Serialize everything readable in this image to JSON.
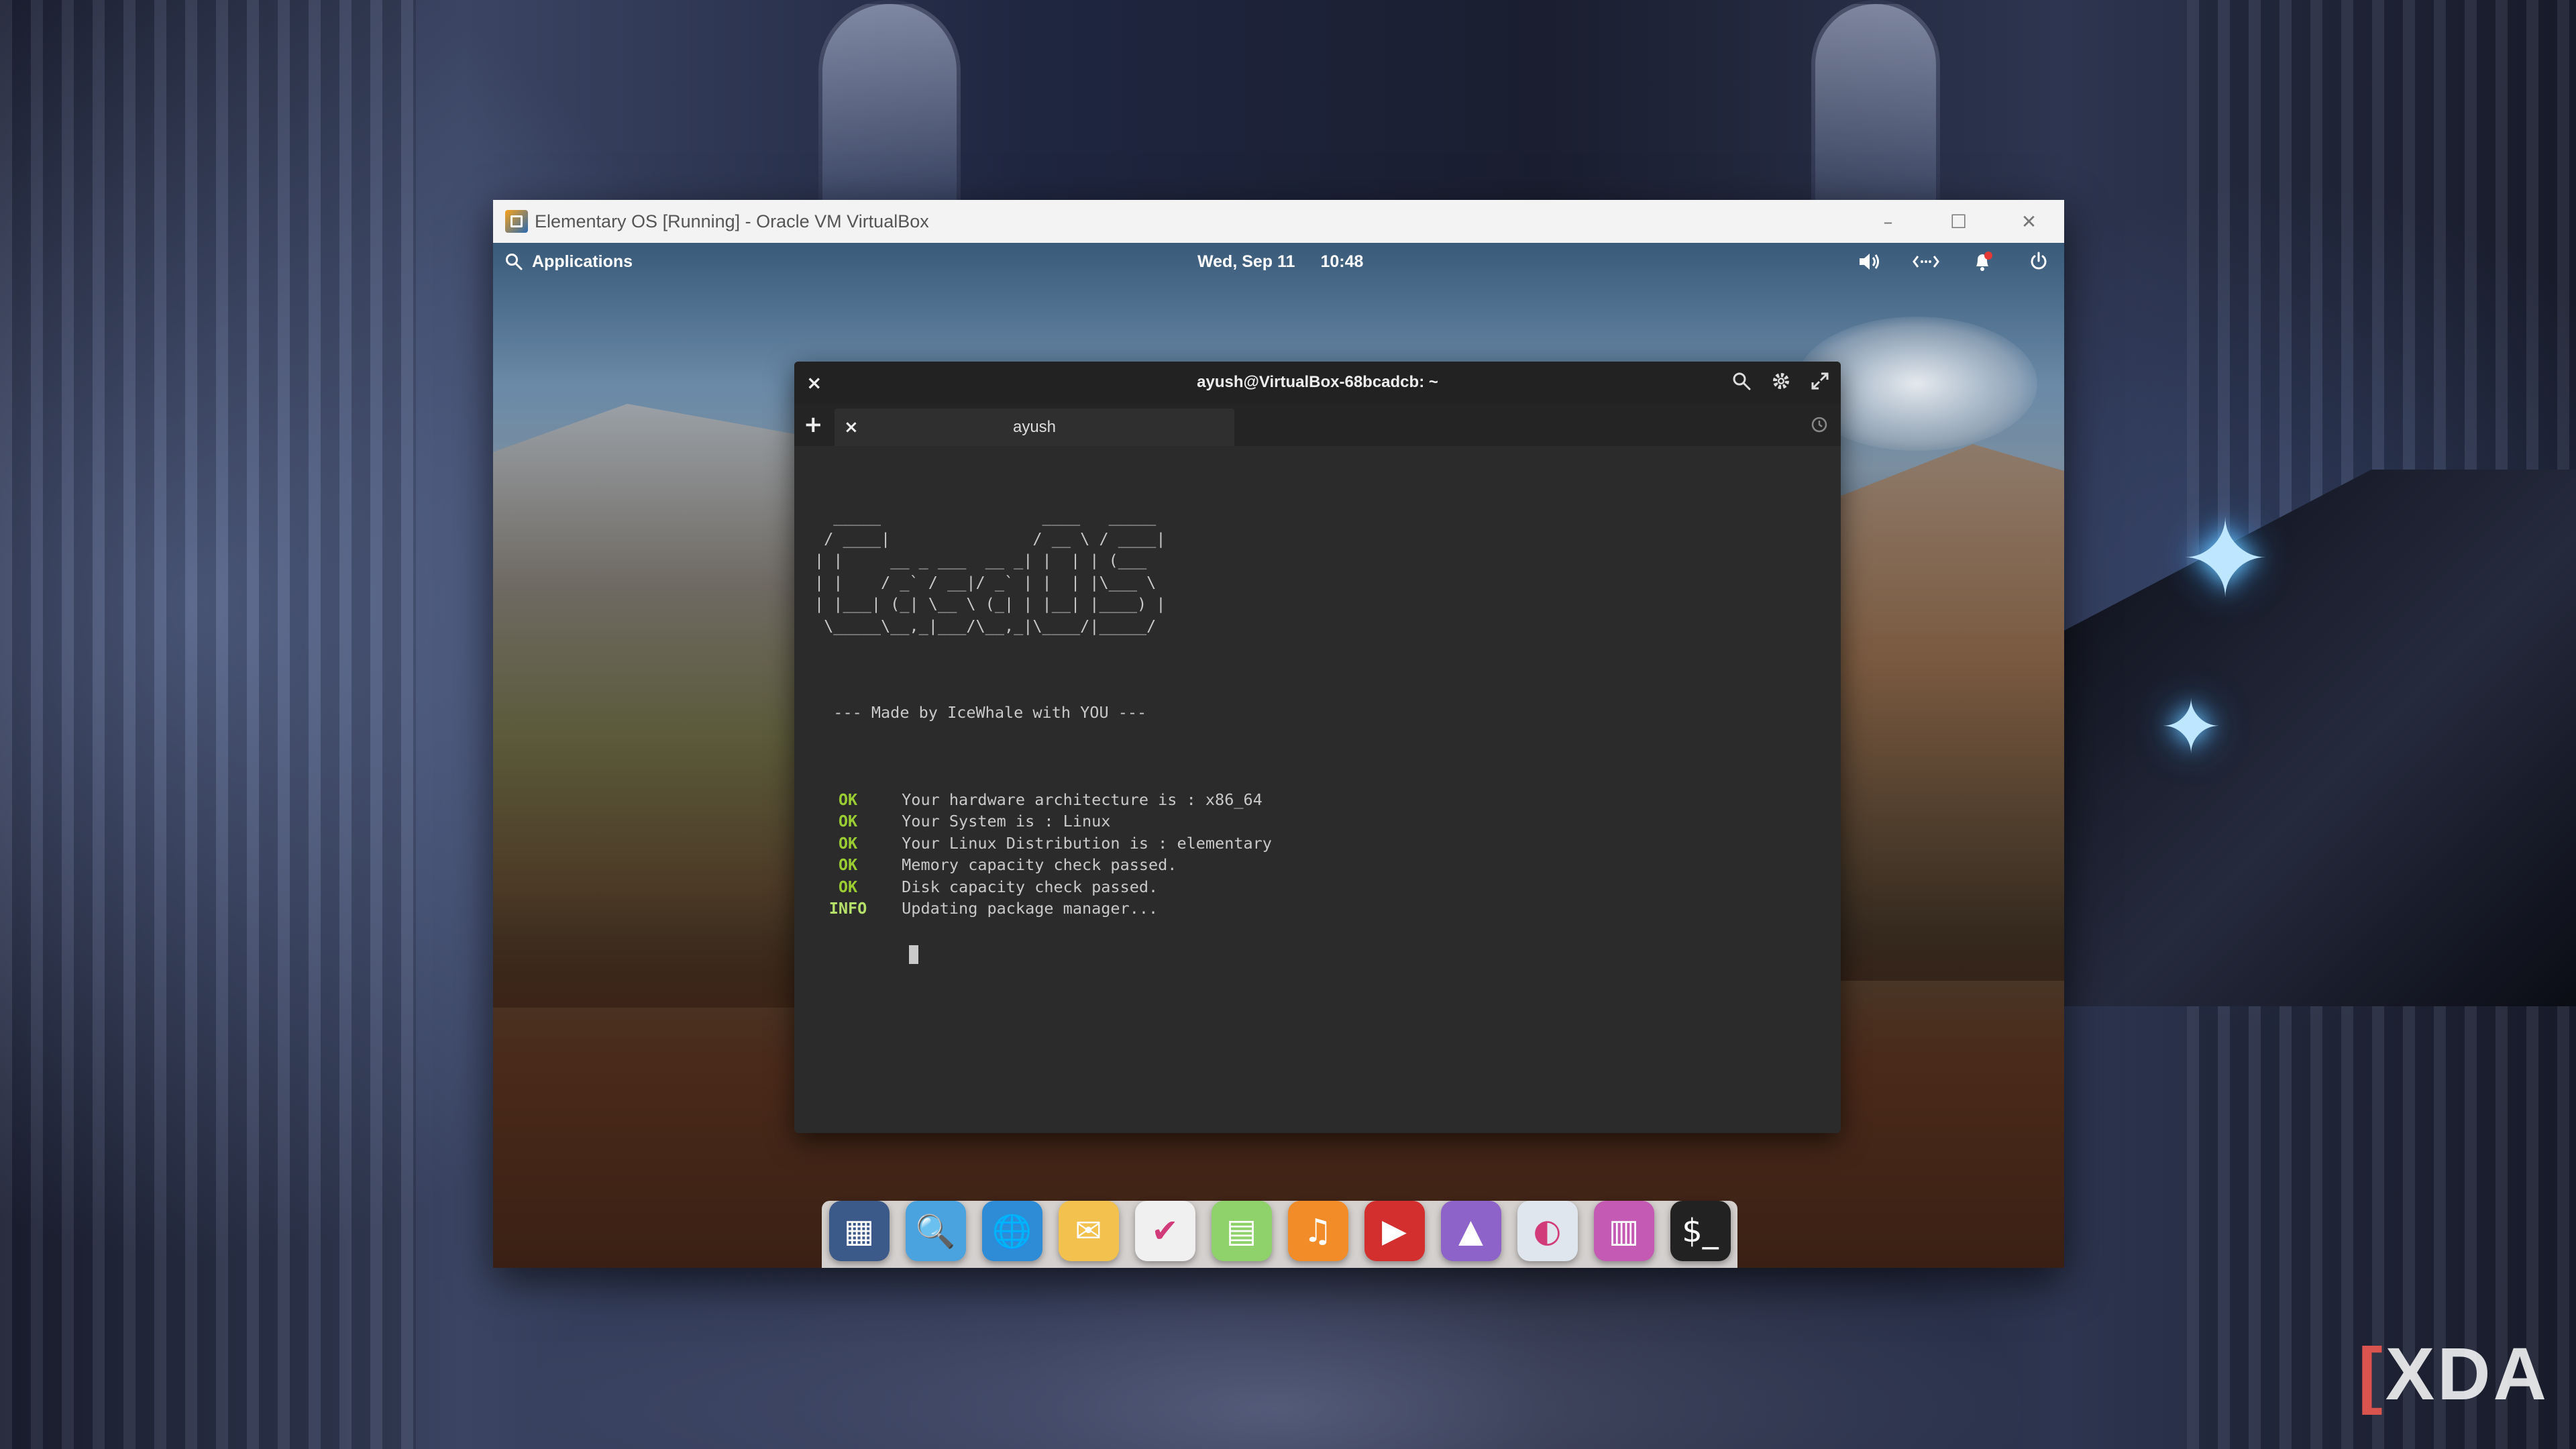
{
  "host": {
    "watermark": "XDA"
  },
  "vbox": {
    "title": "Elementary OS [Running] - Oracle VM VirtualBox",
    "controls": {
      "minimize": "–",
      "maximize": "☐",
      "close": "✕"
    }
  },
  "panel": {
    "applications_label": "Applications",
    "date": "Wed, Sep 11",
    "time": "10:48"
  },
  "terminal": {
    "title": "ayush@VirtualBox-68bcadcb: ~",
    "tab_label": "ayush",
    "ascii_art": "  _____                 ____   _____\n / ____|               / __ \\ / ____|\n| |     __ _ ___  __ _| |  | | (___\n| |    / _` / __|/ _` | |  | |\\___ \\\n| |___| (_| \\__ \\ (_| | |__| |____) |\n \\_____\\__,_|___/\\__,_|\\____/|_____/",
    "made_by": "  --- Made by IceWhale with YOU ---",
    "log": [
      {
        "status": "OK",
        "message": "Your hardware architecture is : x86_64"
      },
      {
        "status": "OK",
        "message": "Your System is : Linux"
      },
      {
        "status": "OK",
        "message": "Your Linux Distribution is : elementary"
      },
      {
        "status": "OK",
        "message": "Memory capacity check passed."
      },
      {
        "status": "OK",
        "message": "Disk capacity check passed."
      },
      {
        "status": "INFO",
        "message": "Updating package manager..."
      }
    ]
  },
  "dock": {
    "items": [
      {
        "name": "multitasking-view",
        "glyph": "▦",
        "color": "#3b5a8a"
      },
      {
        "name": "files",
        "glyph": "🔍",
        "color": "#4aa3df"
      },
      {
        "name": "web-browser",
        "glyph": "🌐",
        "color": "#2e8bd6"
      },
      {
        "name": "mail",
        "glyph": "✉",
        "color": "#f2c14e"
      },
      {
        "name": "tasks",
        "glyph": "✔",
        "color": "#f0f0f0"
      },
      {
        "name": "calendar",
        "glyph": "▤",
        "color": "#8fd16a"
      },
      {
        "name": "music",
        "glyph": "♫",
        "color": "#f28c28"
      },
      {
        "name": "videos",
        "glyph": "▶",
        "color": "#d32f2f"
      },
      {
        "name": "photos",
        "glyph": "▲",
        "color": "#8e63c9"
      },
      {
        "name": "system-settings",
        "glyph": "◐",
        "color": "#dfe6ee"
      },
      {
        "name": "app-center",
        "glyph": "▥",
        "color": "#c45ab3"
      },
      {
        "name": "terminal",
        "glyph": "$_",
        "color": "#222222"
      }
    ]
  }
}
